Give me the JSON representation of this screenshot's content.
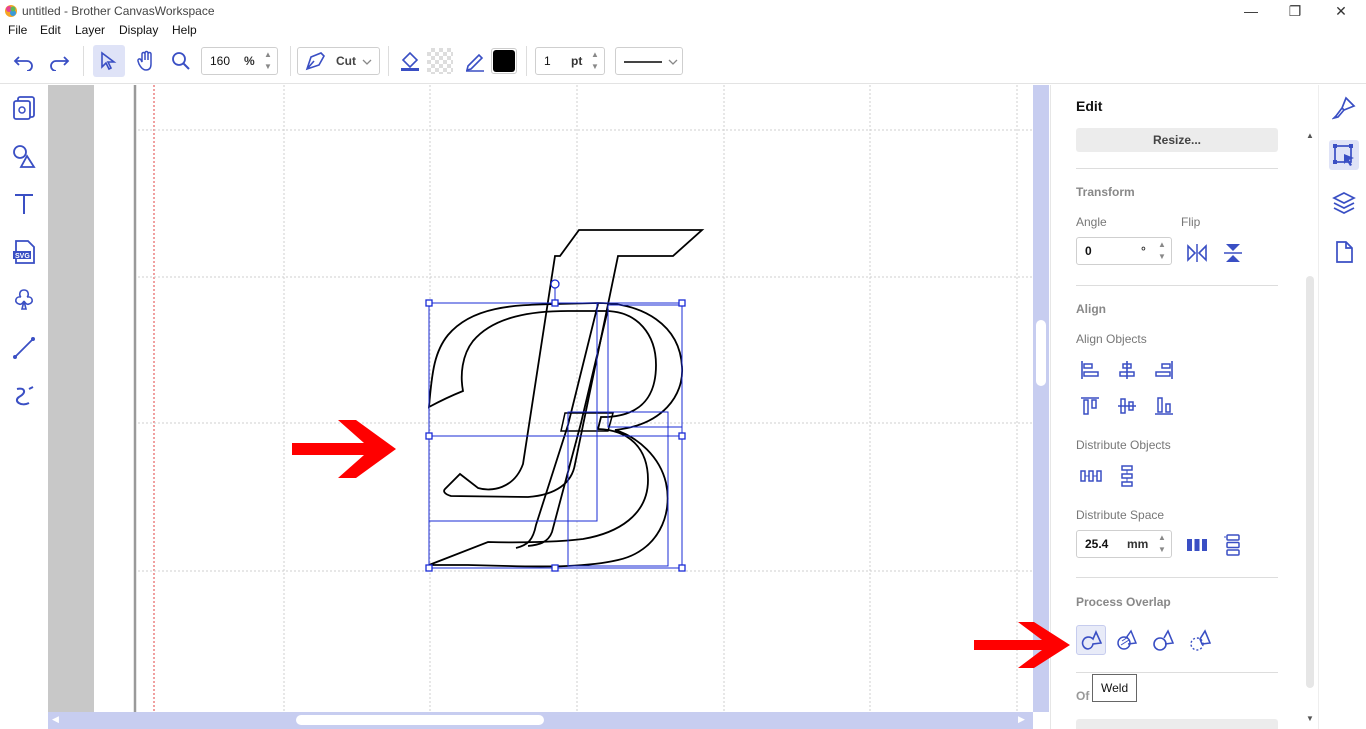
{
  "window": {
    "title": "untitled - Brother CanvasWorkspace",
    "minimize": "—",
    "restore": "❐",
    "close": "✕"
  },
  "menu": [
    "File",
    "Edit",
    "Layer",
    "Display",
    "Help"
  ],
  "toolbar": {
    "zoom_value": "160",
    "zoom_unit": "%",
    "line_mode": "Cut",
    "line_width_value": "1",
    "line_width_unit": "pt",
    "fill_color": "#000000",
    "accent": "#3a4fc4"
  },
  "left_tools": [
    "pages-icon",
    "shapes-icon",
    "text-icon",
    "svg-import-icon",
    "shape-library-icon",
    "line-tool-icon",
    "freehand-icon"
  ],
  "panel": {
    "title": "Edit",
    "resize_button": "Resize...",
    "transform_heading": "Transform",
    "angle_label": "Angle",
    "flip_label": "Flip",
    "angle_value": "0",
    "angle_unit": "°",
    "align_heading": "Align",
    "align_objects_label": "Align Objects",
    "distribute_objects_label": "Distribute Objects",
    "distribute_space_label": "Distribute Space",
    "distribute_space_value": "25.4",
    "distribute_space_unit": "mm",
    "process_overlap_heading": "Process Overlap",
    "next_heading_partial": "Of",
    "tooltip": "Weld"
  },
  "right_tools": [
    "edit-brush-icon",
    "select-edit-icon",
    "layers-icon",
    "page-icon"
  ],
  "colors": {
    "selection_blue": "#1a2bd6",
    "arrow_red": "#ff0000",
    "icon_blue": "#3a4fc4",
    "scrollbar": "#c7cdf0"
  }
}
